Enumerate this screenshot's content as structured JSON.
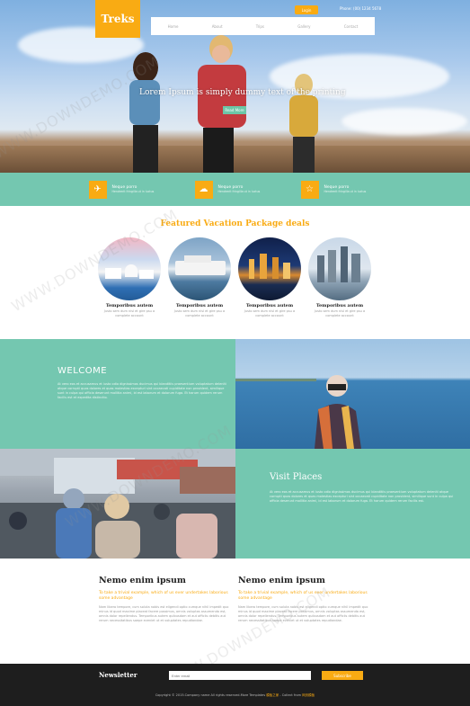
{
  "header": {
    "logo": "Treks",
    "login_label": "Login",
    "phone": "Phone: (00) 1234 5678",
    "nav": [
      "Home",
      "About",
      "Trips",
      "Gallery",
      "Contact"
    ]
  },
  "hero": {
    "title": "Lorem Ipsum is simply dummy text of the printing",
    "button_label": "Read More"
  },
  "features": [
    {
      "icon": "plane-icon",
      "title": "Neque porro",
      "text": "Hendrerit fringilla ut in luctus"
    },
    {
      "icon": "cloud-icon",
      "title": "Neque porro",
      "text": "Hendrerit fringilla ut in luctus"
    },
    {
      "icon": "star-icon",
      "title": "Neque porro",
      "text": "Hendrerit fringilla ut in luctus"
    }
  ],
  "featured": {
    "title": "Featured Vacation Package deals",
    "items": [
      {
        "title": "Temporibus autem",
        "text": "Justo sem dum nisl et gire psu a complete account"
      },
      {
        "title": "Temporibus autem",
        "text": "Justo sem dum nisl et gire psu a complete account"
      },
      {
        "title": "Temporibus autem",
        "text": "Justo sem dum nisl et gire psu a complete account"
      },
      {
        "title": "Temporibus autem",
        "text": "Justo sem dum nisl et gire psu a complete account"
      }
    ]
  },
  "welcome": {
    "title": "WELCOME",
    "text": "At vero eos et accusamus et iusto odio dignissimos ducimus qui blanditiis praesentium voluptatum deleniti atque corrupti quos dolores et quas molestias excepturi sint occaecati cupiditate non provident, similique sunt in culpa qui officia deserunt mollitia animi, id est laborum et dolorum fuga. Et harum quidem rerum facilis est et expedita distinctio."
  },
  "visit": {
    "title": "Visit Places",
    "text": "At vero eos et accusamus et iusto odio dignissimos ducimus qui blanditiis praesentium voluptatum deleniti atque corrupti quos dolores et quas molestias excepturi sint occaecati cupiditate non provident, similique sunt in culpa qui officia deserunt mollitia animi, id est laborum et dolorum fuga. Et harum quidem rerum facilis est."
  },
  "columns": [
    {
      "title": "Nemo enim ipsum",
      "subtitle": "To take a trivial example, which of us ever undertakes laborious some advantage",
      "text": "Nam libero tempore, cum soluta nobis est eligendi optio cumque nihil impedit quo minus id quod maxime placeat facere possimus, omnis voluptas assumenda est, omnis dolor repellendus. Temporibus autem quibusdam et aut officiis debitis aut rerum necessitatibus saepe eveniet ut et voluptates repudiandae."
    },
    {
      "title": "Nemo enim ipsum",
      "subtitle": "To take a trivial example, which of us ever undertakes laborious some advantage",
      "text": "Nam libero tempore, cum soluta nobis est eligendi optio cumque nihil impedit quo minus id quod maxime placeat facere possimus, omnis voluptas assumenda est, omnis dolor repellendus. Temporibus autem quibusdam et aut officiis debitis aut rerum necessitatibus saepe eveniet ut et voluptates repudiandae."
    }
  ],
  "footer": {
    "newsletter_label": "Newsletter",
    "email_placeholder": "Enter email",
    "subscribe_label": "Subscribe",
    "copyright_prefix": "Copyright © 2015.Company name All rights reserved.More Templates",
    "copyright_link1": "模板之家",
    "copyright_mid": "- Collect from",
    "copyright_link2": "网页模板"
  },
  "watermark": "WWW.DOWNDEMO.COM",
  "colors": {
    "accent": "#f9ab13",
    "teal": "#74c7b0",
    "dark": "#1e1e1e"
  }
}
